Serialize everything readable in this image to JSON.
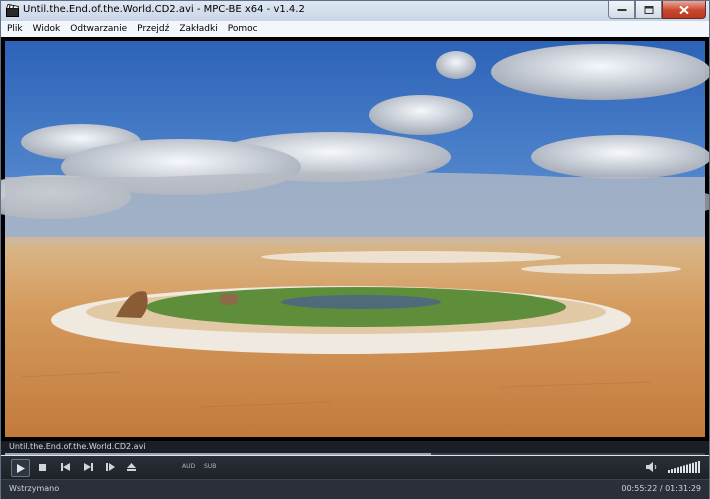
{
  "window": {
    "title": "Until.the.End.of.the.World.CD2.avi - MPC-BE x64 - v1.4.2"
  },
  "menu": [
    "Plik",
    "Widok",
    "Odtwarzanie",
    "Przejdź",
    "Zakładki",
    "Pomoc"
  ],
  "player": {
    "filename": "Until.the.End.of.the.World.CD2.avi",
    "seek_fraction": 0.608,
    "volume_level": 1.0,
    "audio_label": "AUD",
    "subtitle_label": "SUB",
    "status": "Wstrzymano",
    "time": "00:55:22 / 01:31:29"
  },
  "colors": {
    "titlebar": "#c9d6e6",
    "controls_bg": "#1e2228",
    "close_button": "#c9462c"
  }
}
